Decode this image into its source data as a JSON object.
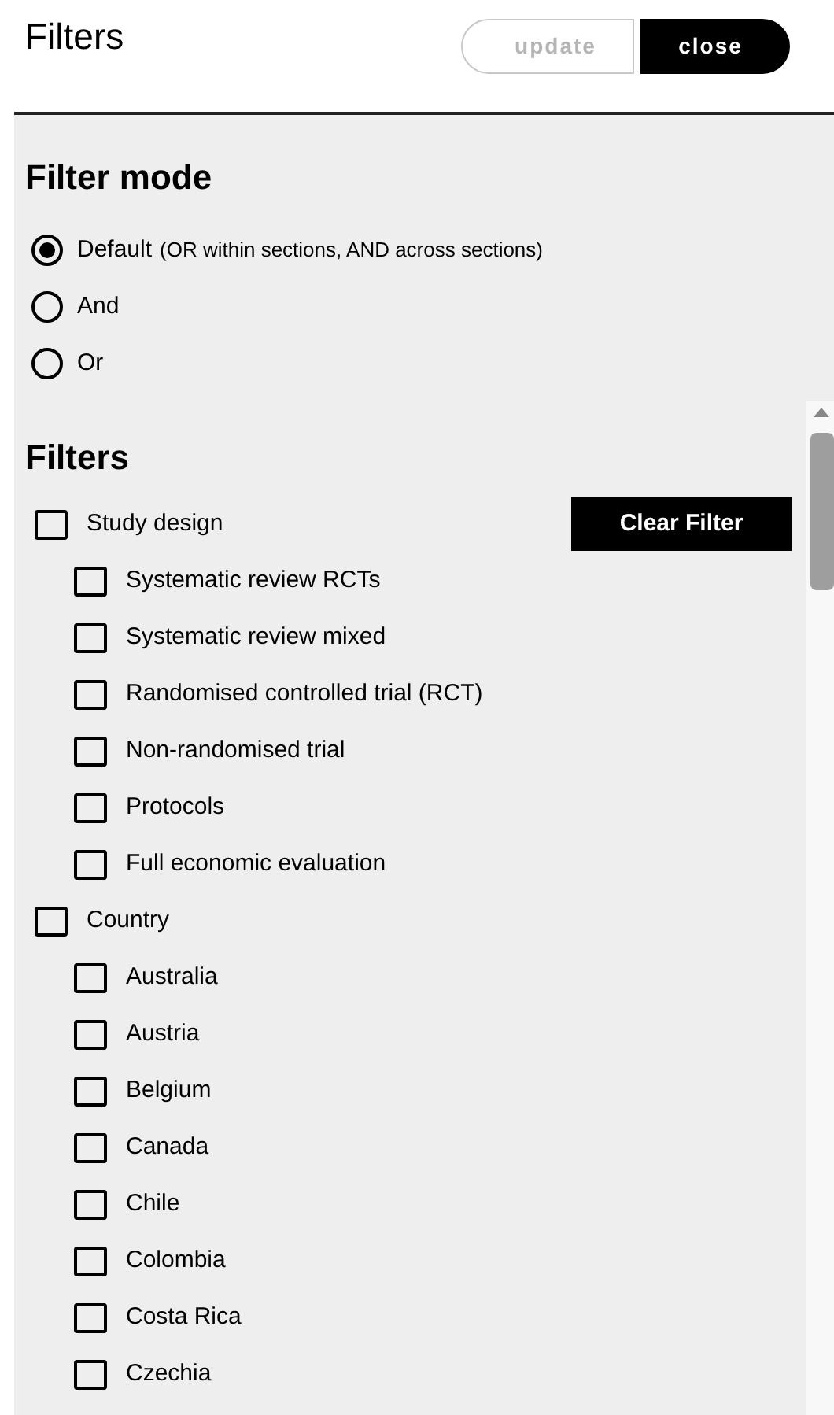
{
  "header": {
    "title": "Filters",
    "buttons": [
      {
        "label": "update",
        "disabled": true
      },
      {
        "label": "close",
        "disabled": false
      }
    ]
  },
  "filter_mode": {
    "title": "Filter mode",
    "options": [
      {
        "label": "Default",
        "note": "(OR within sections, AND across sections)",
        "selected": true
      },
      {
        "label": "And",
        "selected": false
      },
      {
        "label": "Or",
        "selected": false
      }
    ]
  },
  "filters": {
    "title": "Filters",
    "groups": [
      {
        "label": "Study design",
        "checked": false,
        "clear_button": "Clear Filter",
        "children": [
          {
            "label": "Systematic review RCTs",
            "checked": false
          },
          {
            "label": "Systematic review mixed",
            "checked": false
          },
          {
            "label": "Randomised controlled trial (RCT)",
            "checked": false
          },
          {
            "label": "Non-randomised trial",
            "checked": false
          },
          {
            "label": "Protocols",
            "checked": false
          },
          {
            "label": "Full economic evaluation",
            "checked": false
          }
        ]
      },
      {
        "label": "Country",
        "checked": false,
        "children": [
          {
            "label": "Australia",
            "checked": false
          },
          {
            "label": "Austria",
            "checked": false
          },
          {
            "label": "Belgium",
            "checked": false
          },
          {
            "label": "Canada",
            "checked": false
          },
          {
            "label": "Chile",
            "checked": false
          },
          {
            "label": "Colombia",
            "checked": false
          },
          {
            "label": "Costa Rica",
            "checked": false
          },
          {
            "label": "Czechia",
            "checked": false
          }
        ]
      }
    ]
  }
}
